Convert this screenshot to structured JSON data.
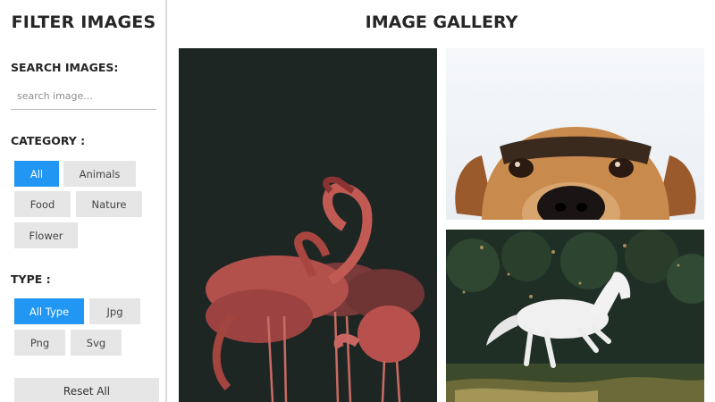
{
  "sidebar": {
    "title": "FILTER IMAGES",
    "search": {
      "label": "SEARCH IMAGES:",
      "placeholder": "search image..."
    },
    "category": {
      "label": "CATEGORY :",
      "options": [
        "All",
        "Animals",
        "Food",
        "Nature",
        "Flower"
      ],
      "selected": "All"
    },
    "type": {
      "label": "TYPE :",
      "options": [
        "All Type",
        "Jpg",
        "Png",
        "Svg"
      ],
      "selected": "All Type"
    },
    "reset_label": "Reset All"
  },
  "main": {
    "title": "IMAGE GALLERY",
    "images": [
      {
        "subject": "flamingos"
      },
      {
        "subject": "dog"
      },
      {
        "subject": "horse"
      }
    ]
  },
  "colors": {
    "accent": "#2196f3",
    "chip_bg": "#e6e6e6"
  }
}
